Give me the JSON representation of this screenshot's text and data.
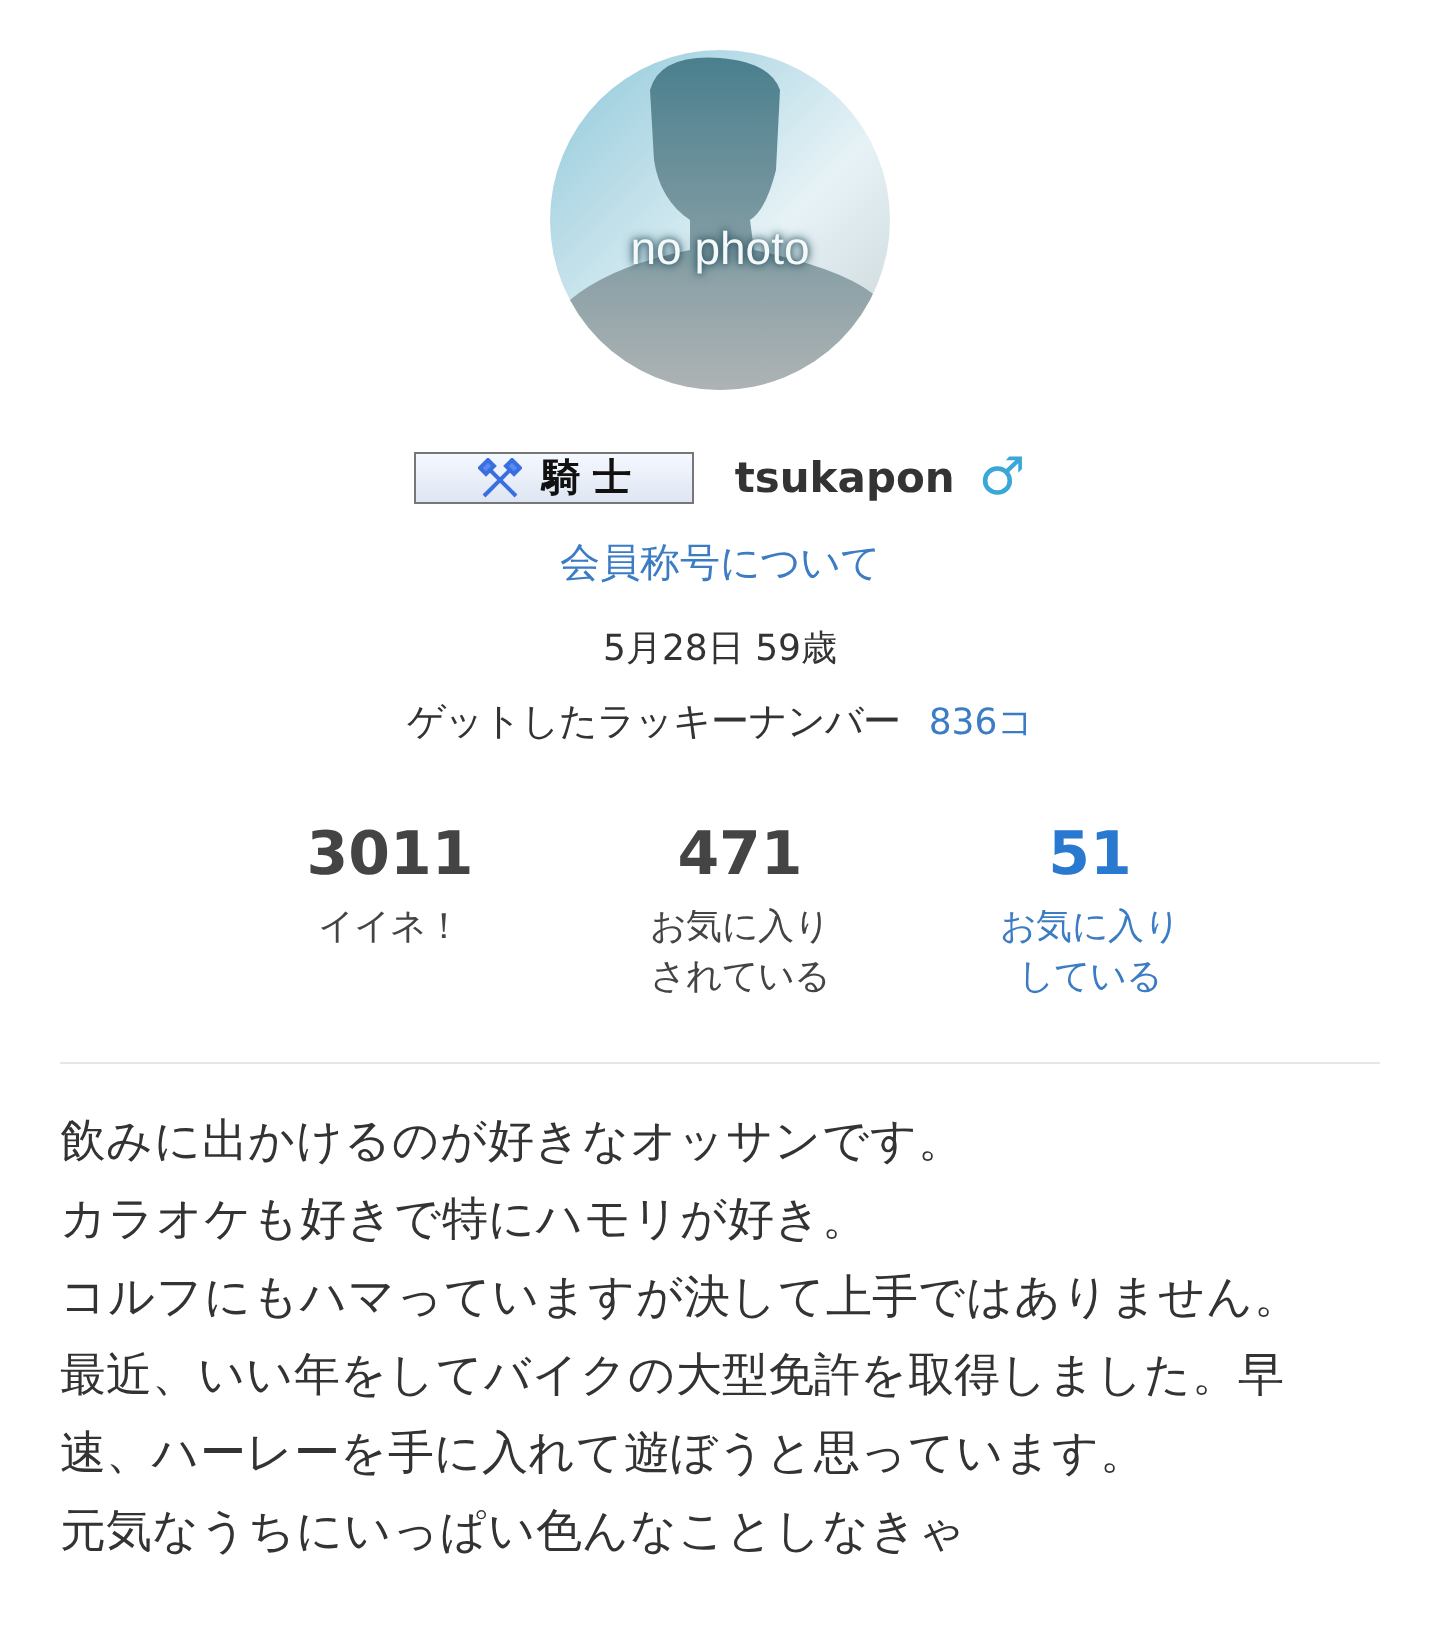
{
  "profile": {
    "avatar_text": "no photo",
    "rank_badge": "騎 士",
    "username": "tsukapon",
    "gender_symbol": "♂",
    "title_link": "会員称号について",
    "birthday": "5月28日 59歳",
    "lucky_label": "ゲットしたラッキーナンバー",
    "lucky_count": "836コ"
  },
  "stats": [
    {
      "value": "3011",
      "label": "イイネ！",
      "link": false
    },
    {
      "value": "471",
      "label": "お気に入りされている",
      "link": false
    },
    {
      "value": "51",
      "label": "お気に入りしている",
      "link": true
    }
  ],
  "bio": [
    "飲みに出かけるのが好きなオッサンです。",
    "カラオケも好きで特にハモリが好き。",
    "コルフにもハマっていますが決して上手ではありません。",
    "最近、いい年をしてバイクの大型免許を取得しました。早速、ハーレーを手に入れて遊ぼうと思っています。",
    "元気なうちにいっぱい色んなことしなきゃ"
  ]
}
